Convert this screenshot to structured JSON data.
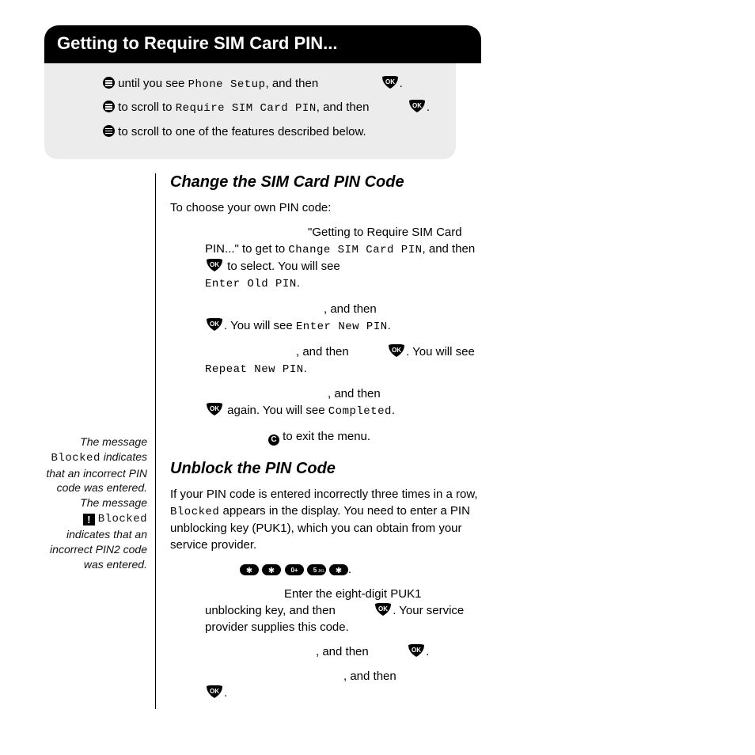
{
  "title": "Getting to Require SIM Card PIN...",
  "instr": {
    "l1a": " until you see ",
    "l1b": "Phone Setup",
    "l1c": ", and then ",
    "l1d": ".",
    "l2a": " to scroll to ",
    "l2b": "Require SIM Card PIN",
    "l2c": ", and then ",
    "l2d": ".",
    "l3": " to scroll to one of the features described below."
  },
  "section1": {
    "heading": "Change the SIM Card PIN Code",
    "intro": "To choose your own PIN code:",
    "s1a": "\"Getting to Require SIM Card PIN...\" to get to ",
    "s1b": "Change SIM Card PIN",
    "s1c": ", and then ",
    "s1d": " to select. You will see ",
    "s1e": "Enter Old PIN",
    "s1f": ".",
    "s2a": ", and then ",
    "s2b": ". You will see ",
    "s2c": "Enter New PIN",
    "s2d": ".",
    "s3a": ", and then ",
    "s3b": ". You will see ",
    "s3c": "Repeat New PIN",
    "s3d": ".",
    "s4a": ", and then ",
    "s4b": " again. You will see ",
    "s4c": "Completed",
    "s4d": ".",
    "s5a": " to exit the menu."
  },
  "section2": {
    "heading": "Unblock the PIN Code",
    "p1a": "If your PIN code is entered incorrectly three times in a row, ",
    "p1b": "Blocked",
    "p1c": " appears in the display. You need to enter a PIN unblocking key (PUK1), which you can obtain from your service provider.",
    "k_dot": ".",
    "s2a": "Enter the eight-digit PUK1 unblocking key, and then ",
    "s2b": ". Your service provider supplies this code.",
    "s3a": ", and then ",
    "s3b": ".",
    "s4a": ", and then ",
    "s4b": "."
  },
  "note": {
    "t1": "The message ",
    "t2": "Blocked",
    "t3": " indicates that an incorrect PIN code was entered. The message ",
    "t4": "Blocked",
    "t5": " indicates that an incorrect PIN2 code was entered."
  },
  "keys": {
    "zero": "0+",
    "five": "5",
    "star": "✱"
  }
}
